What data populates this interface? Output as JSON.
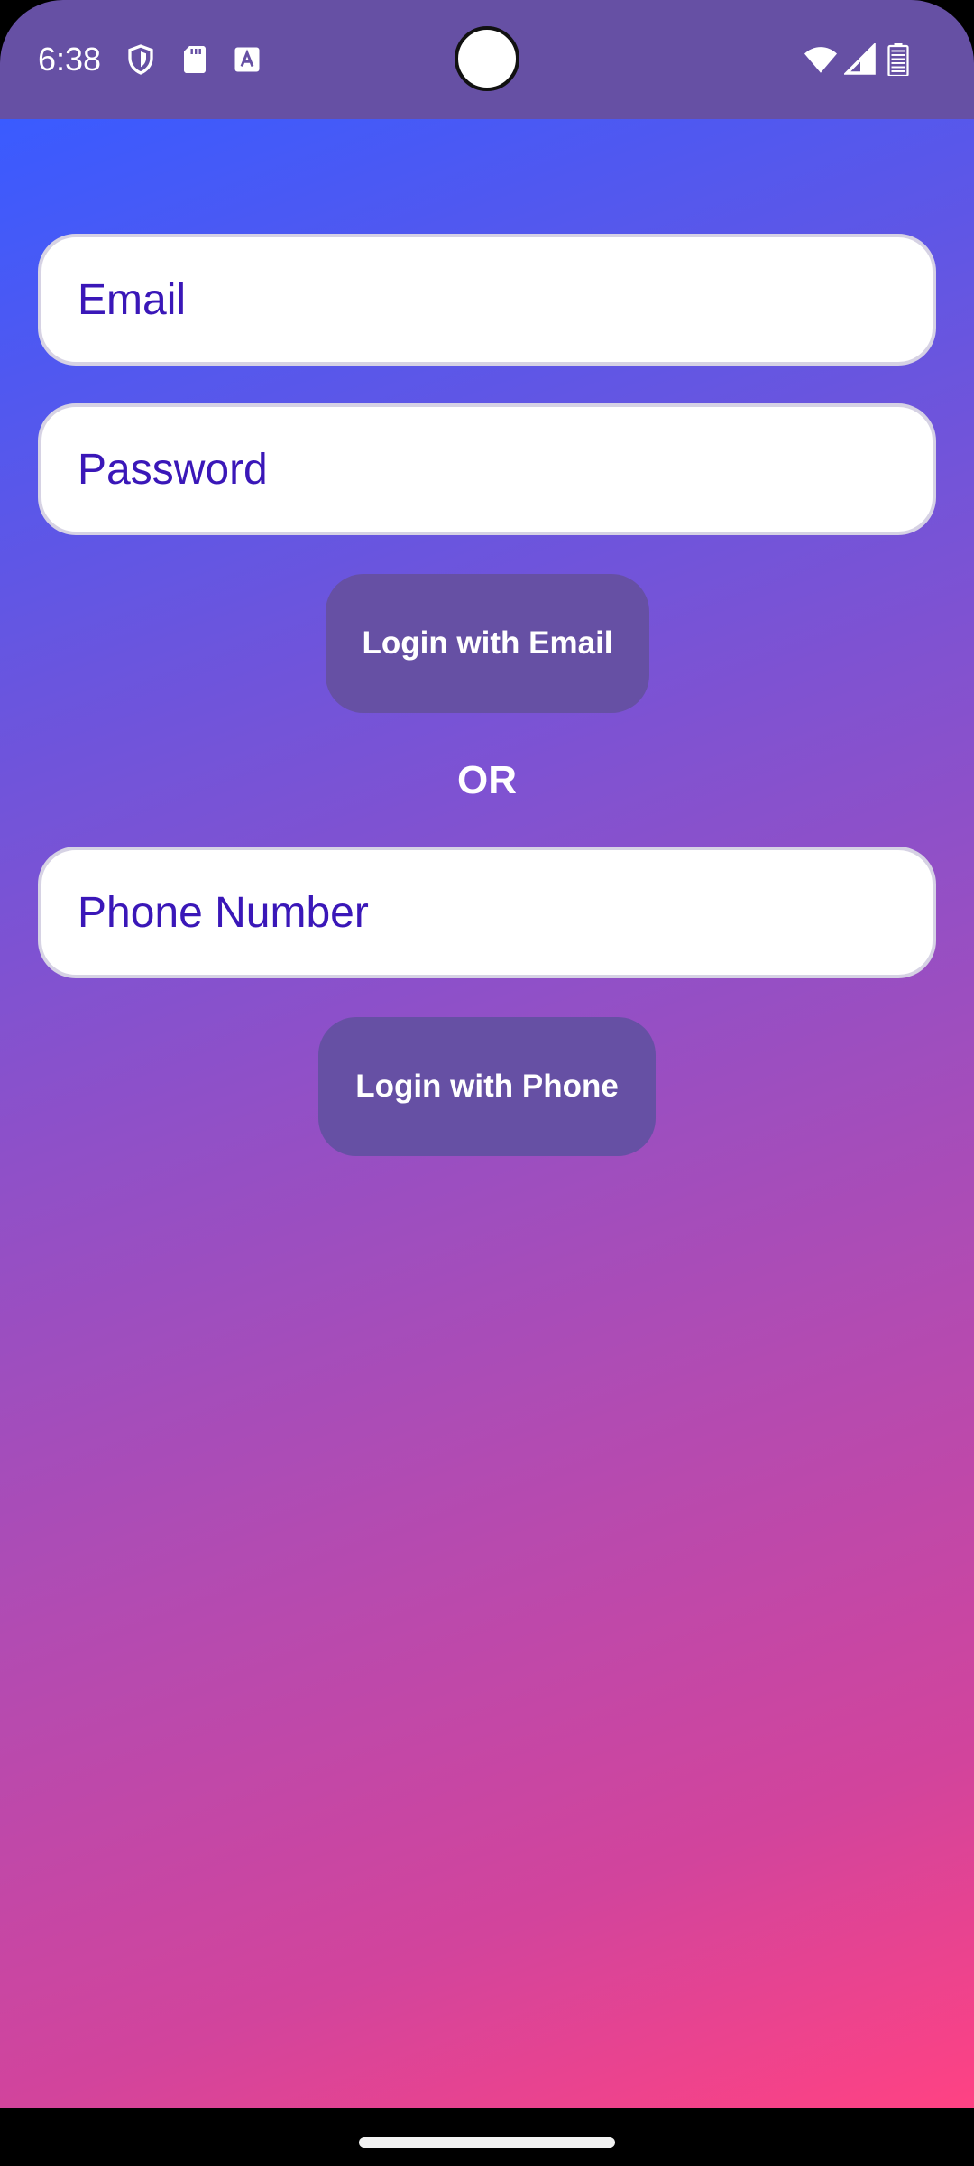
{
  "status_bar": {
    "time": "6:38",
    "icons_left": [
      "shield-icon",
      "sd-card-icon",
      "font-a-icon"
    ],
    "icons_right": [
      "wifi-icon",
      "cell-signal-icon",
      "battery-icon"
    ]
  },
  "form": {
    "email_placeholder": "Email",
    "password_placeholder": "Password",
    "login_email_label": "Login with Email",
    "or_label": "OR",
    "phone_placeholder": "Phone Number",
    "login_phone_label": "Login with Phone"
  },
  "colors": {
    "status_bar": "#6650a4",
    "button": "#6650a4",
    "input_text": "#3a17b8",
    "gradient_top": "#3a5bff",
    "gradient_bottom": "#ff4283"
  }
}
